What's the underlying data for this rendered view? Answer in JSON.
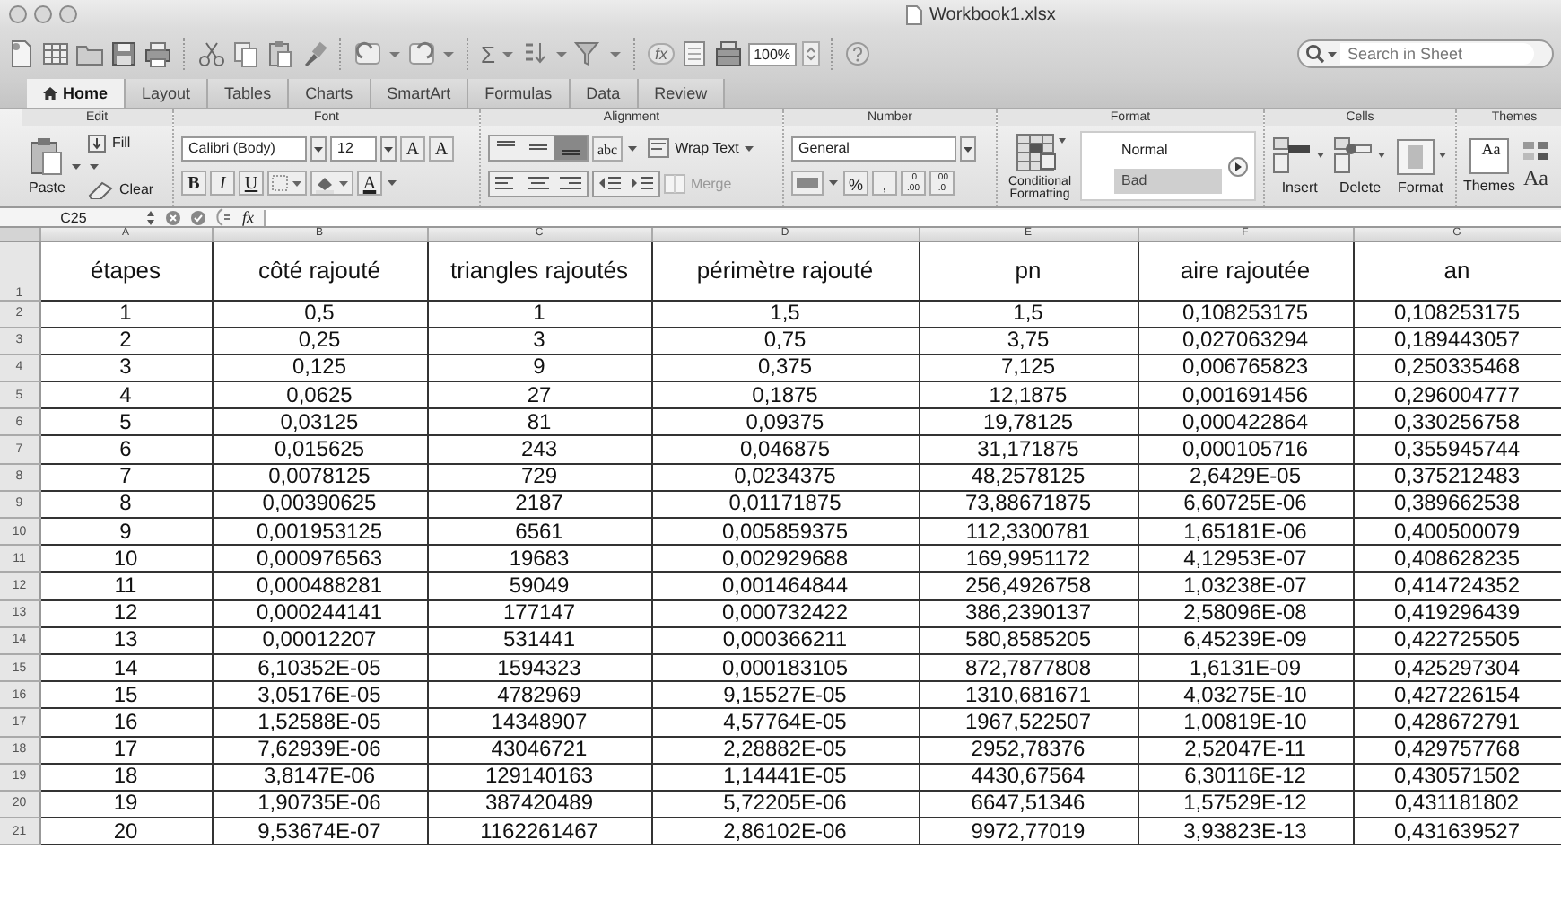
{
  "window": {
    "title": "Workbook1.xlsx"
  },
  "toolbar": {
    "sum": "Σ",
    "function": "fx",
    "zoom": "100%",
    "search": {
      "placeholder": "Search in Sheet"
    }
  },
  "tabs": [
    {
      "label": "Home",
      "selected": true
    },
    {
      "label": "Layout",
      "selected": false
    },
    {
      "label": "Tables",
      "selected": false
    },
    {
      "label": "Charts",
      "selected": false
    },
    {
      "label": "SmartArt",
      "selected": false
    },
    {
      "label": "Formulas",
      "selected": false
    },
    {
      "label": "Data",
      "selected": false
    },
    {
      "label": "Review",
      "selected": false
    }
  ],
  "ribbon": [
    {
      "kind": "edit",
      "title": "Edit",
      "paste": "Paste",
      "fill": "Fill",
      "clear": "Clear"
    },
    {
      "kind": "font",
      "title": "Font",
      "font": "Calibri (Body)",
      "size": "12",
      "grow": "A",
      "shrink": "A",
      "bold": "B",
      "italic": "I",
      "underline": "U",
      "font_color": "A"
    },
    {
      "kind": "alignment",
      "title": "Alignment",
      "vertical": [
        {
          "selected": false
        },
        {
          "selected": false
        },
        {
          "selected": true
        }
      ],
      "orientation": "abc",
      "wrap": "Wrap Text",
      "merge": {
        "label": "Merge",
        "disabled": true
      }
    },
    {
      "kind": "number",
      "title": "Number",
      "format": "General",
      "percent": "%",
      "comma": ",",
      "increase_decimal": [
        ".0",
        ".00"
      ],
      "decrease_decimal": [
        ".00",
        ".0"
      ]
    },
    {
      "kind": "format",
      "title": "Format",
      "conditional": "Conditional Formatting",
      "styles": [
        {
          "label": "Normal",
          "kind": "normal"
        },
        {
          "label": "Bad",
          "kind": "bad"
        }
      ]
    },
    {
      "kind": "cells",
      "title": "Cells",
      "buttons": [
        "Insert",
        "Delete",
        "Format"
      ]
    },
    {
      "kind": "themes",
      "title": "Themes",
      "icon_text": "Aa",
      "themes": "Themes",
      "sample": "Aa"
    }
  ],
  "formula_bar": {
    "cell": "C25",
    "function": "fx"
  },
  "sheet": {
    "columns": [
      "A",
      "B",
      "C",
      "D",
      "E",
      "F",
      "G"
    ],
    "rows": [
      {
        "number": "1",
        "kind": "header",
        "cells": [
          "étapes",
          "côté rajouté",
          "triangles rajoutés",
          "périmètre rajouté",
          "pn",
          "aire rajoutée",
          "an"
        ]
      },
      {
        "number": "2",
        "kind": "data",
        "cells": [
          "1",
          "0,5",
          "1",
          "1,5",
          "1,5",
          "0,108253175",
          "0,108253175"
        ]
      },
      {
        "number": "3",
        "kind": "data",
        "cells": [
          "2",
          "0,25",
          "3",
          "0,75",
          "3,75",
          "0,027063294",
          "0,189443057"
        ]
      },
      {
        "number": "4",
        "kind": "data",
        "cells": [
          "3",
          "0,125",
          "9",
          "0,375",
          "7,125",
          "0,006765823",
          "0,250335468"
        ]
      },
      {
        "number": "5",
        "kind": "data",
        "cells": [
          "4",
          "0,0625",
          "27",
          "0,1875",
          "12,1875",
          "0,001691456",
          "0,296004777"
        ]
      },
      {
        "number": "6",
        "kind": "data",
        "cells": [
          "5",
          "0,03125",
          "81",
          "0,09375",
          "19,78125",
          "0,000422864",
          "0,330256758"
        ]
      },
      {
        "number": "7",
        "kind": "data",
        "cells": [
          "6",
          "0,015625",
          "243",
          "0,046875",
          "31,171875",
          "0,000105716",
          "0,355945744"
        ]
      },
      {
        "number": "8",
        "kind": "data",
        "cells": [
          "7",
          "0,0078125",
          "729",
          "0,0234375",
          "48,2578125",
          "2,6429E-05",
          "0,375212483"
        ]
      },
      {
        "number": "9",
        "kind": "data",
        "cells": [
          "8",
          "0,00390625",
          "2187",
          "0,01171875",
          "73,88671875",
          "6,60725E-06",
          "0,389662538"
        ]
      },
      {
        "number": "10",
        "kind": "data",
        "cells": [
          "9",
          "0,001953125",
          "6561",
          "0,005859375",
          "112,3300781",
          "1,65181E-06",
          "0,400500079"
        ]
      },
      {
        "number": "11",
        "kind": "data",
        "cells": [
          "10",
          "0,000976563",
          "19683",
          "0,002929688",
          "169,9951172",
          "4,12953E-07",
          "0,408628235"
        ]
      },
      {
        "number": "12",
        "kind": "data",
        "cells": [
          "11",
          "0,000488281",
          "59049",
          "0,001464844",
          "256,4926758",
          "1,03238E-07",
          "0,414724352"
        ]
      },
      {
        "number": "13",
        "kind": "data",
        "cells": [
          "12",
          "0,000244141",
          "177147",
          "0,000732422",
          "386,2390137",
          "2,58096E-08",
          "0,419296439"
        ]
      },
      {
        "number": "14",
        "kind": "data",
        "cells": [
          "13",
          "0,00012207",
          "531441",
          "0,000366211",
          "580,8585205",
          "6,45239E-09",
          "0,422725505"
        ]
      },
      {
        "number": "15",
        "kind": "data",
        "cells": [
          "14",
          "6,10352E-05",
          "1594323",
          "0,000183105",
          "872,7877808",
          "1,6131E-09",
          "0,425297304"
        ]
      },
      {
        "number": "16",
        "kind": "data",
        "cells": [
          "15",
          "3,05176E-05",
          "4782969",
          "9,15527E-05",
          "1310,681671",
          "4,03275E-10",
          "0,427226154"
        ]
      },
      {
        "number": "17",
        "kind": "data",
        "cells": [
          "16",
          "1,52588E-05",
          "14348907",
          "4,57764E-05",
          "1967,522507",
          "1,00819E-10",
          "0,428672791"
        ]
      },
      {
        "number": "18",
        "kind": "data",
        "cells": [
          "17",
          "7,62939E-06",
          "43046721",
          "2,28882E-05",
          "2952,78376",
          "2,52047E-11",
          "0,429757768"
        ]
      },
      {
        "number": "19",
        "kind": "data",
        "cells": [
          "18",
          "3,8147E-06",
          "129140163",
          "1,14441E-05",
          "4430,67564",
          "6,30116E-12",
          "0,430571502"
        ]
      },
      {
        "number": "20",
        "kind": "data",
        "cells": [
          "19",
          "1,90735E-06",
          "387420489",
          "5,72205E-06",
          "6647,51346",
          "1,57529E-12",
          "0,431181802"
        ]
      },
      {
        "number": "21",
        "kind": "data",
        "cells": [
          "20",
          "9,53674E-07",
          "1162261467",
          "2,86102E-06",
          "9972,77019",
          "3,93823E-13",
          "0,431639527"
        ]
      }
    ]
  }
}
